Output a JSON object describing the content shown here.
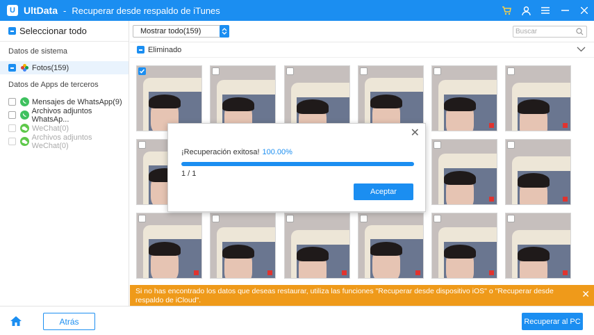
{
  "titlebar": {
    "app_name": "UltData",
    "separator": "-",
    "subtitle": "Recuperar desde respaldo de iTunes",
    "logo_letter": "U",
    "icons": [
      "cart-icon",
      "user-icon",
      "menu-icon",
      "minimize-icon",
      "close-icon"
    ]
  },
  "sidebar": {
    "select_all": "Seleccionar todo",
    "system_section": "Datos de sistema",
    "photos": "Fotos(159)",
    "apps_section": "Datos de Apps de terceros",
    "items": [
      {
        "label": "Mensajes de WhatsApp(9)",
        "enabled": true
      },
      {
        "label": "Archivos adjuntos WhatsAp...",
        "enabled": true
      },
      {
        "label": "WeChat(0)",
        "enabled": false
      },
      {
        "label": "Archivos adjuntos WeChat(0)",
        "enabled": false
      }
    ]
  },
  "main": {
    "filter_value": "Mostrar todo(159)",
    "search_placeholder": "Buscar",
    "group_label": "Eliminado"
  },
  "dialog": {
    "message": "¡Recuperación exitosa!",
    "percent": "100.00%",
    "progress": 1.0,
    "count": "1 / 1",
    "accept": "Aceptar"
  },
  "notice": {
    "text": "Si no has encontrado los datos que deseas restaurar, utiliza las funciones \"Recuperar desde dispositivo iOS\" o \"Recuperar desde respaldo de iCloud\"."
  },
  "footer": {
    "back": "Atrás",
    "recover": "Recuperar al PC"
  },
  "colors": {
    "accent": "#1b8ef1",
    "notice": "#ef9a1a"
  }
}
